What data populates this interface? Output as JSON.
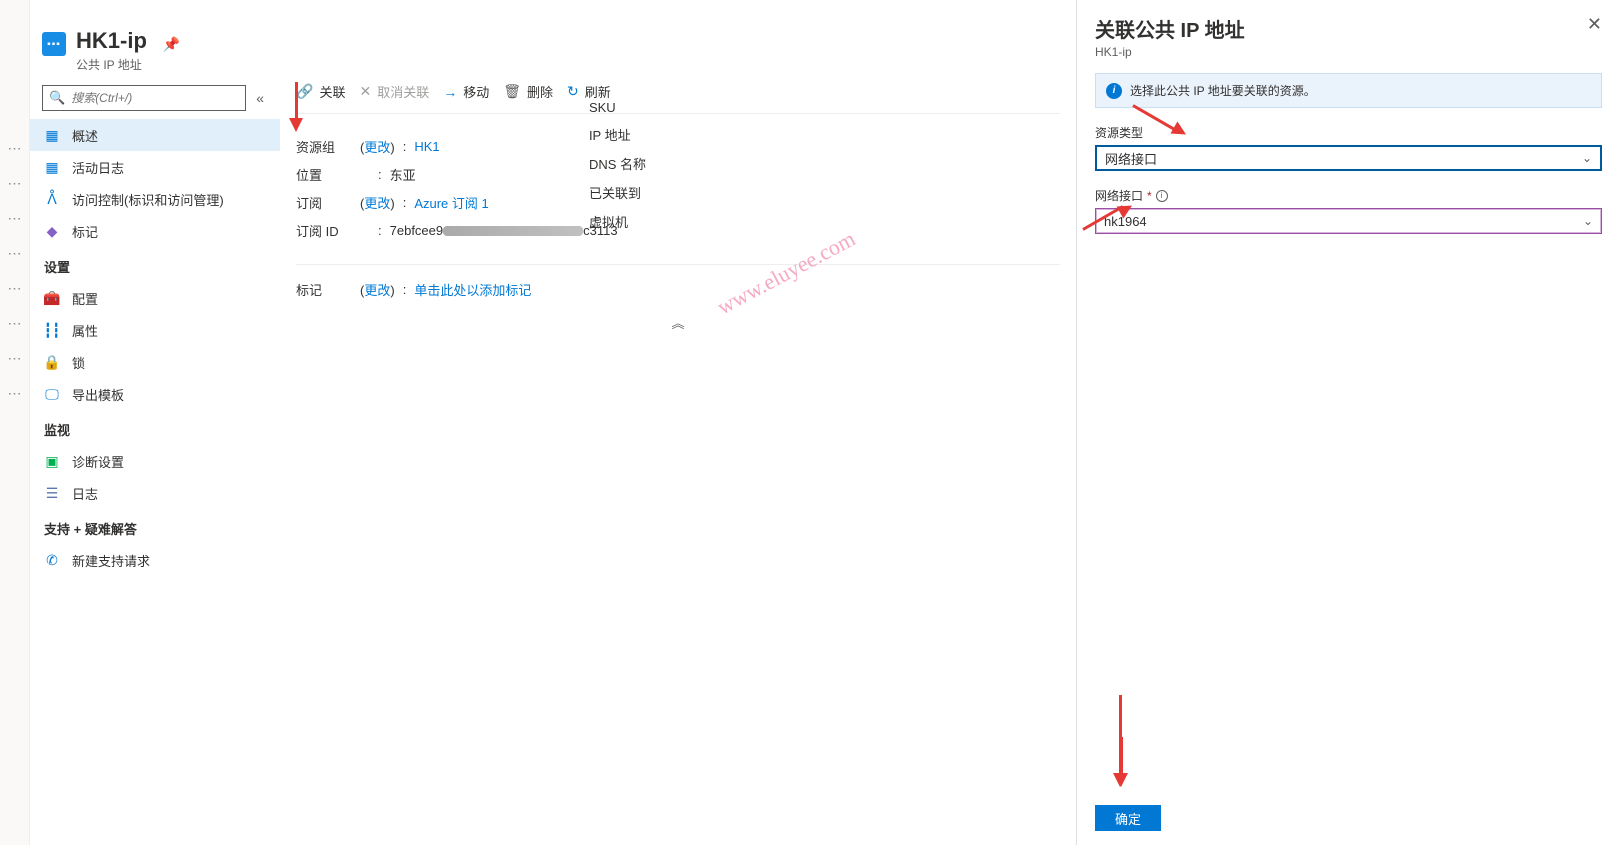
{
  "header": {
    "title": "HK1-ip",
    "subtitle": "公共 IP 地址"
  },
  "search": {
    "placeholder": "搜索(Ctrl+/)"
  },
  "nav": {
    "items": [
      {
        "label": "概述"
      },
      {
        "label": "活动日志"
      },
      {
        "label": "访问控制(标识和访问管理)"
      },
      {
        "label": "标记"
      }
    ],
    "sections": [
      {
        "title": "设置",
        "items": [
          {
            "label": "配置"
          },
          {
            "label": "属性"
          },
          {
            "label": "锁"
          },
          {
            "label": "导出模板"
          }
        ]
      },
      {
        "title": "监视",
        "items": [
          {
            "label": "诊断设置"
          },
          {
            "label": "日志"
          }
        ]
      },
      {
        "title": "支持 + 疑难解答",
        "items": [
          {
            "label": "新建支持请求"
          }
        ]
      }
    ]
  },
  "toolbar": {
    "associate": "关联",
    "disassociate": "取消关联",
    "move": "移动",
    "delete": "删除",
    "refresh": "刷新"
  },
  "props": {
    "rg_label": "资源组",
    "change": "更改",
    "rg_val": "HK1",
    "loc_label": "位置",
    "loc_val": "东亚",
    "sub_label": "订阅",
    "sub_val": "Azure 订阅 1",
    "subid_label": "订阅 ID",
    "subid_prefix": "7ebfcee9",
    "subid_suffix": "c3113",
    "tags_label": "标记",
    "tags_val": "单击此处以添加标记"
  },
  "right_labels": {
    "sku": "SKU",
    "ip": "IP 地址",
    "dns": "DNS 名称",
    "assoc": "已关联到",
    "vm": "虚拟机"
  },
  "watermark": "www.eluyee.com",
  "panel": {
    "title": "关联公共 IP 地址",
    "subtitle": "HK1-ip",
    "info": "选择此公共 IP 地址要关联的资源。",
    "field1_label": "资源类型",
    "field1_value": "网络接口",
    "field2_label": "网络接口",
    "field2_value": "hk1964",
    "ok": "确定"
  }
}
